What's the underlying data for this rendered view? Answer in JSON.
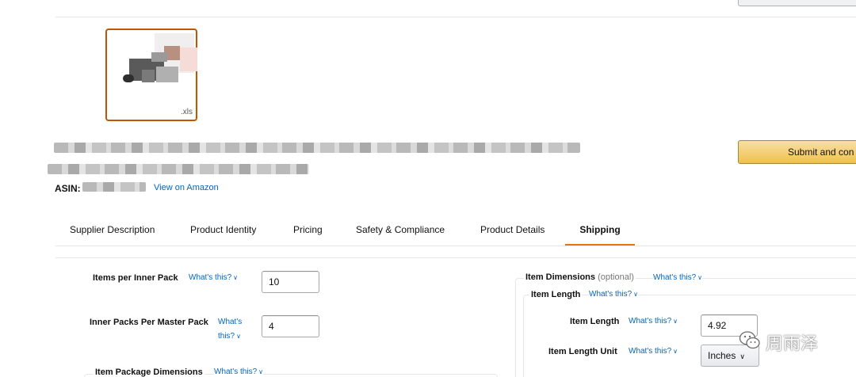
{
  "thumbnail": {
    "extension": ".xls"
  },
  "product": {
    "asin_label": "ASIN:",
    "view_link": "View on Amazon"
  },
  "actions": {
    "submit_label": "Submit and con"
  },
  "tabs": [
    {
      "label": "Supplier Description"
    },
    {
      "label": "Product Identity"
    },
    {
      "label": "Pricing"
    },
    {
      "label": "Safety & Compliance"
    },
    {
      "label": "Product Details"
    },
    {
      "label": "Shipping"
    }
  ],
  "active_tab": "Shipping",
  "help_text": "What's this?",
  "fields": {
    "items_per_inner_pack": {
      "label": "Items per Inner Pack",
      "value": "10"
    },
    "inner_packs_per_master_pack": {
      "label_line1": "Inner Packs Per Master Pack",
      "help_line1": "What's",
      "help_line2": "this?",
      "value": "4"
    },
    "item_package_dimensions": {
      "label": "Item Package Dimensions"
    }
  },
  "item_dimensions": {
    "label": "Item Dimensions",
    "optional": "(optional)",
    "item_length_group": "Item Length",
    "item_length": {
      "label": "Item Length",
      "value": "4.92"
    },
    "item_length_unit": {
      "label": "Item Length Unit",
      "selected": "Inches"
    }
  },
  "watermark": {
    "text": "周雨泽",
    "icon": "wechat-icon"
  },
  "colors": {
    "accent_orange": "#e77600",
    "link_blue": "#0066c0",
    "button_yellow": "#f0c14b"
  }
}
